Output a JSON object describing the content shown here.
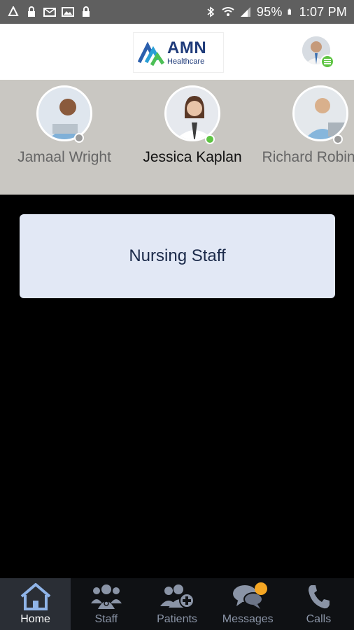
{
  "status_bar": {
    "battery": "95%",
    "time": "1:07 PM",
    "left_icons": [
      "tree-icon",
      "lock-icon",
      "mail-icon",
      "image-icon",
      "lock-icon"
    ],
    "right_icons": [
      "bluetooth-icon",
      "wifi-icon",
      "signal-icon",
      "battery-icon"
    ]
  },
  "header": {
    "logo_title": "AMN",
    "logo_subtitle": "Healthcare"
  },
  "contacts": [
    {
      "name": "Jamaal Wright",
      "status": "offline",
      "active": false
    },
    {
      "name": "Jessica Kaplan",
      "status": "online",
      "active": true
    },
    {
      "name": "Richard Robinson",
      "status": "offline",
      "active": false
    }
  ],
  "main": {
    "group_label": "Nursing Staff"
  },
  "nav": {
    "items": [
      {
        "label": "Home",
        "icon": "home-icon",
        "active": true
      },
      {
        "label": "Staff",
        "icon": "staff-icon",
        "active": false
      },
      {
        "label": "Patients",
        "icon": "patients-icon",
        "active": false
      },
      {
        "label": "Messages",
        "icon": "messages-icon",
        "active": false,
        "notification": true
      },
      {
        "label": "Calls",
        "icon": "phone-icon",
        "active": false
      }
    ]
  },
  "colors": {
    "online": "#5ec443",
    "offline": "#9a9a9a",
    "notification": "#f5a623",
    "brand": "#1f3b7a"
  }
}
